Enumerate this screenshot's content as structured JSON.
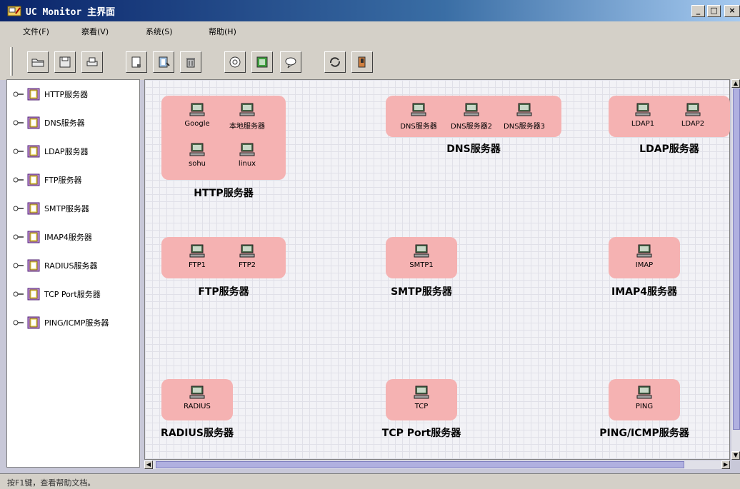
{
  "window": {
    "title": "UC Monitor 主界面",
    "controls": [
      "_",
      "□",
      "×"
    ]
  },
  "menu": [
    "文件(F)",
    "察看(V)",
    "系统(S)",
    "帮助(H)"
  ],
  "toolbar": {
    "buttons": [
      "open-icon",
      "save-icon",
      "print-icon",
      "new-document-icon",
      "edit-document-icon",
      "delete-icon",
      "info-icon",
      "help-icon",
      "chat-icon",
      "refresh-icon",
      "exit-icon"
    ]
  },
  "sidebar": {
    "items": [
      "HTTP服务器",
      "DNS服务器",
      "LDAP服务器",
      "FTP服务器",
      "SMTP服务器",
      "IMAP4服务器",
      "RADIUS服务器",
      "TCP Port服务器",
      "PING/ICMP服务器"
    ]
  },
  "groups": [
    {
      "title": "HTTP服务器",
      "nodes": [
        "Google",
        "本地服务器",
        "sohu",
        "linux"
      ]
    },
    {
      "title": "DNS服务器",
      "nodes": [
        "DNS服务器",
        "DNS服务器2",
        "DNS服务器3"
      ]
    },
    {
      "title": "LDAP服务器",
      "nodes": [
        "LDAP1",
        "LDAP2"
      ]
    },
    {
      "title": "FTP服务器",
      "nodes": [
        "FTP1",
        "FTP2"
      ]
    },
    {
      "title": "SMTP服务器",
      "nodes": [
        "SMTP1"
      ]
    },
    {
      "title": "IMAP4服务器",
      "nodes": [
        "IMAP"
      ]
    },
    {
      "title": "RADIUS服务器",
      "nodes": [
        "RADIUS"
      ]
    },
    {
      "title": "TCP Port服务器",
      "nodes": [
        "TCP"
      ]
    },
    {
      "title": "PING/ICMP服务器",
      "nodes": [
        "PING"
      ]
    }
  ],
  "status": "按F1键，查看帮助文档。",
  "colors": {
    "group_fill": "#f5b2b2",
    "title_bar": "#0a246a"
  }
}
